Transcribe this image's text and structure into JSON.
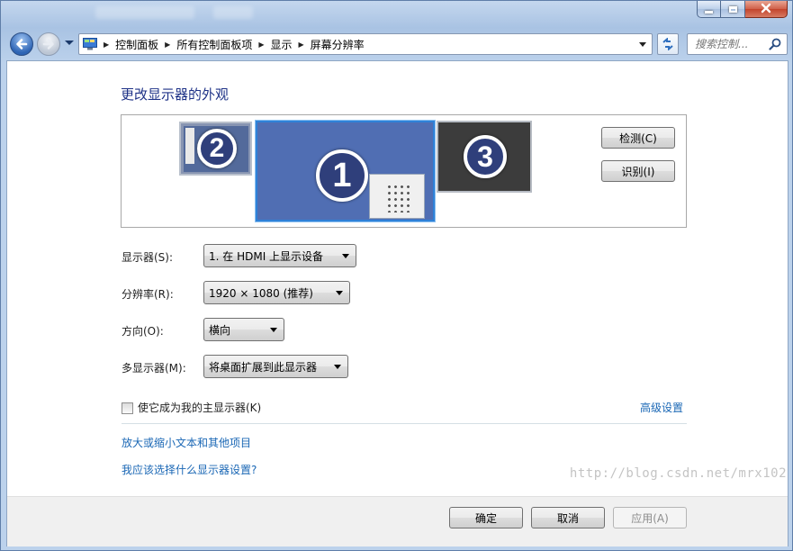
{
  "window": {
    "caption_buttons": {
      "minimize_icon": "minimize-icon",
      "maximize_icon": "maximize-icon",
      "close_icon": "close-icon"
    }
  },
  "navigation": {
    "back_icon": "back-arrow-icon",
    "forward_icon": "forward-arrow-icon",
    "breadcrumbs": [
      "控制面板",
      "所有控制面板项",
      "显示",
      "屏幕分辨率"
    ],
    "search_placeholder": "搜索控制..."
  },
  "page": {
    "heading": "更改显示器的外观",
    "monitors": [
      {
        "number": "2"
      },
      {
        "number": "1",
        "selected": true
      },
      {
        "number": "3"
      }
    ],
    "detect_button": "检测(C)",
    "identify_button": "识别(I)",
    "settings": {
      "display_label": "显示器(S):",
      "display_value": "1. 在 HDMI 上显示设备",
      "resolution_label": "分辨率(R):",
      "resolution_value": "1920 × 1080 (推荐)",
      "orientation_label": "方向(O):",
      "orientation_value": "横向",
      "multiple_label": "多显示器(M):",
      "multiple_value": "将桌面扩展到此显示器"
    },
    "main_display_checkbox": "使它成为我的主显示器(K)",
    "main_display_checked": false,
    "advanced_link": "高级设置",
    "text_size_link": "放大或缩小文本和其他项目",
    "which_settings_link": "我应该选择什么显示器设置?"
  },
  "footer": {
    "ok_button": "确定",
    "cancel_button": "取消",
    "apply_button": "应用(A)",
    "apply_enabled": false
  },
  "watermark": "http://blog.csdn.net/mrx102"
}
